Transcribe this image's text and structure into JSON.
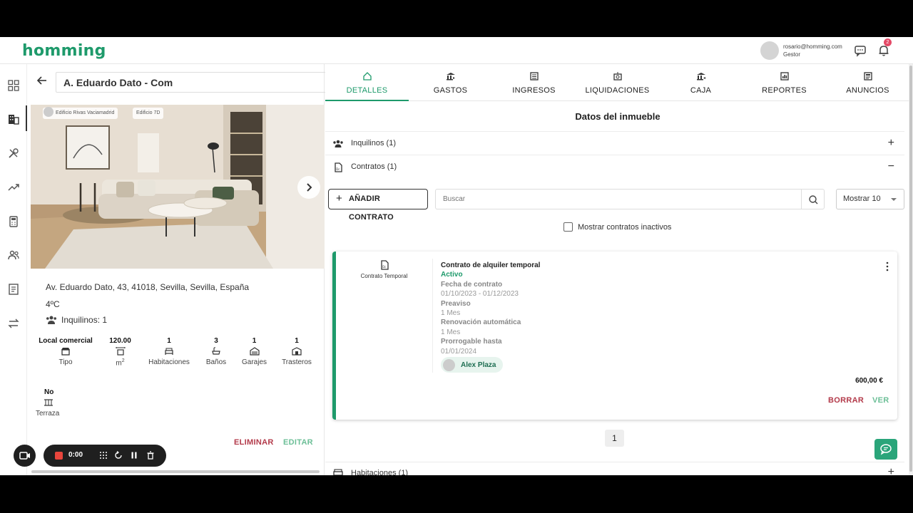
{
  "app": {
    "logo": "homming"
  },
  "user": {
    "email": "rosario@homming.com",
    "role": "Gestor",
    "notifications": "2"
  },
  "property": {
    "search_value": "A. Eduardo Dato - Com",
    "photo_tags": [
      "Edificio Rivas Vaciamadrid",
      "Edificio 7D"
    ],
    "address": "Av. Eduardo Dato, 43, 41018, Sevilla, Sevilla, España",
    "floor": "4ºC",
    "tenants": "Inquilinos: 1",
    "features": [
      {
        "value": "Local comercial",
        "label": "Tipo",
        "icon": "store-icon"
      },
      {
        "value": "120.00",
        "label": "m",
        "icon": "area-icon"
      },
      {
        "value": "1",
        "label": "Habitaciones",
        "icon": "bed-icon"
      },
      {
        "value": "3",
        "label": "Baños",
        "icon": "bath-icon"
      },
      {
        "value": "1",
        "label": "Garajes",
        "icon": "garage-icon"
      },
      {
        "value": "1",
        "label": "Trasteros",
        "icon": "storage-icon"
      },
      {
        "value": "No",
        "label": "Terraza",
        "icon": "terrace-icon"
      }
    ],
    "area_sup": "2",
    "delete_label": "ELIMINAR",
    "edit_label": "EDITAR"
  },
  "recorder": {
    "time": "0:00"
  },
  "tabs": [
    {
      "label": "DETALLES",
      "icon": "home-icon",
      "active": true
    },
    {
      "label": "GASTOS",
      "icon": "expense-icon"
    },
    {
      "label": "INGRESOS",
      "icon": "income-icon"
    },
    {
      "label": "LIQUIDACIONES",
      "icon": "settlement-icon"
    },
    {
      "label": "CAJA",
      "icon": "cash-icon"
    },
    {
      "label": "REPORTES",
      "icon": "report-icon"
    },
    {
      "label": "ANUNCIOS",
      "icon": "ad-icon"
    }
  ],
  "details": {
    "title": "Datos del inmueble",
    "tenants_row": "Inquilinos (1)",
    "contracts_row": "Contratos (1)",
    "rooms_row": "Habitaciones (1)",
    "add_contract": "AÑADIR CONTRATO",
    "search_placeholder": "Buscar",
    "show_select": "Mostrar 10",
    "show_inactive": "Mostrar contratos inactivos"
  },
  "contract": {
    "type": "Contrato Temporal",
    "title": "Contrato de alquiler temporal",
    "status": "Activo",
    "date_label": "Fecha de contrato",
    "date_value": "01/10/2023 - 01/12/2023",
    "notice_label": "Preaviso",
    "notice_value": "1 Mes",
    "renewal_label": "Renovación automática",
    "renewal_value": "1 Mes",
    "extend_label": "Prorrogable hasta",
    "extend_value": "01/01/2024",
    "tenant": "Alex Plaza",
    "price": "600,00 €",
    "delete_label": "BORRAR",
    "view_label": "VER"
  },
  "pagination": {
    "current": "1"
  },
  "colors": {
    "accent": "#1e9a6b",
    "danger": "#b33a4a",
    "badge": "#e44a67"
  }
}
